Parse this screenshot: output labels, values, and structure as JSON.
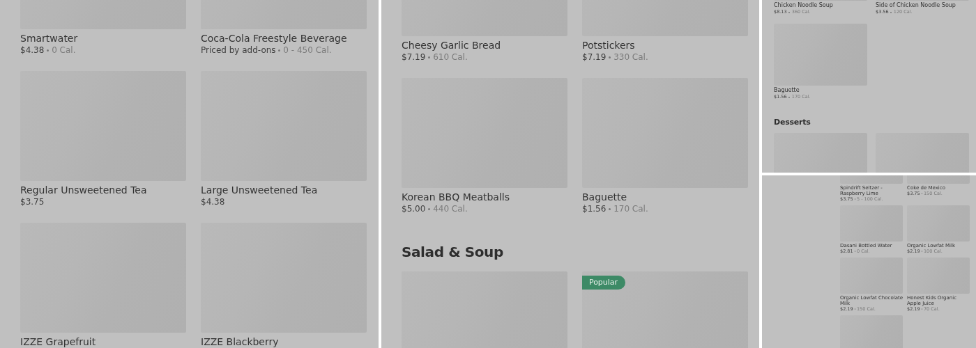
{
  "panels": [
    {
      "sections": [
        {
          "items": [
            {
              "kind": "item",
              "name": "Smartwater",
              "price": "$4.38",
              "calories": "0 Cal."
            },
            {
              "kind": "item",
              "name": "Coca-Cola Freestyle Beverage",
              "price": "Priced by add-ons",
              "calories": "0 - 450 Cal."
            },
            {
              "kind": "item",
              "name": "Regular Unsweetened Tea",
              "price": "$3.75"
            },
            {
              "kind": "item",
              "name": "Large Unsweetened Tea",
              "price": "$4.38"
            },
            {
              "kind": "item",
              "name": "IZZE Grapefruit"
            },
            {
              "kind": "item",
              "name": "IZZE Blackberry"
            }
          ]
        }
      ]
    },
    {
      "sections": [
        {
          "items": [
            {
              "kind": "item",
              "name": "Cheesy Garlic Bread",
              "price": "$7.19",
              "calories": "610 Cal."
            },
            {
              "kind": "item",
              "name": "Potstickers",
              "price": "$7.19",
              "calories": "330 Cal."
            },
            {
              "kind": "item",
              "name": "Korean BBQ Meatballs",
              "price": "$5.00",
              "calories": "440 Cal."
            },
            {
              "kind": "item",
              "name": "Baguette",
              "price": "$1.56",
              "calories": "170 Cal."
            }
          ]
        },
        {
          "heading": "Salad & Soup",
          "items": [
            {
              "kind": "image_only"
            },
            {
              "kind": "image_only",
              "badge": "Popular"
            }
          ]
        }
      ]
    },
    {
      "sections": [
        {
          "items": [
            {
              "kind": "item",
              "name": "Chicken Noodle Soup",
              "price": "$8.13",
              "calories": "360 Cal."
            },
            {
              "kind": "item",
              "name": "Side of Chicken Noodle Soup",
              "price": "$3.56",
              "calories": "120 Cal."
            },
            {
              "kind": "item",
              "name": "Baguette",
              "price": "$1.56",
              "calories": "170 Cal."
            }
          ]
        },
        {
          "heading": "Desserts",
          "items": [
            {
              "kind": "image_only"
            },
            {
              "kind": "image_only"
            }
          ]
        }
      ]
    },
    {
      "sections": [
        {
          "items": [
            {
              "kind": "item",
              "name": "Spindrift Seltzer - Raspberry Lime",
              "price": "$3.75",
              "calories": "5 - 100 Cal."
            },
            {
              "kind": "item",
              "name": "Coke de Mexico",
              "price": "$3.75",
              "calories": "150 Cal."
            },
            {
              "kind": "item",
              "name": "Dasani Bottled Water",
              "price": "$2.81",
              "calories": "0 Cal."
            },
            {
              "kind": "item",
              "name": "Organic Lowfat Milk",
              "price": "$2.19",
              "calories": "100 Cal."
            },
            {
              "kind": "item",
              "name": "Organic Lowfat Chocolate Milk",
              "price": "$2.19",
              "calories": "150 Cal."
            },
            {
              "kind": "item",
              "name": "Honest Kids Organic Apple Juice",
              "price": "$2.19",
              "calories": "70 Cal."
            },
            {
              "kind": "image_only"
            }
          ]
        }
      ]
    }
  ]
}
